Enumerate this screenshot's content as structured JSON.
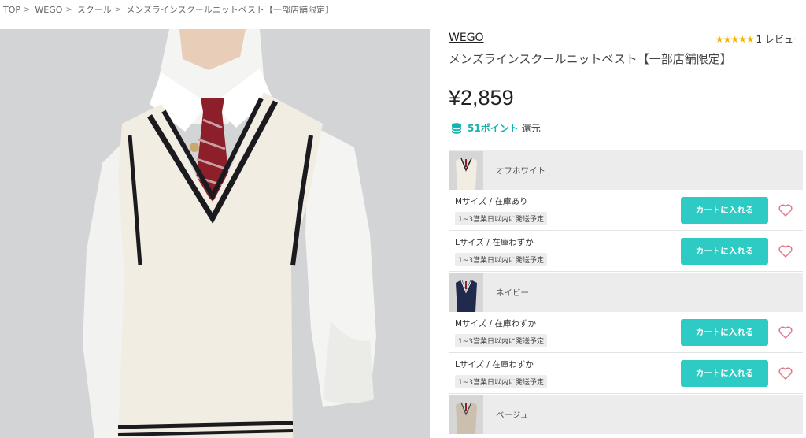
{
  "breadcrumb": [
    {
      "label": "TOP"
    },
    {
      "label": "WEGO"
    },
    {
      "label": "スクール"
    },
    {
      "label": "メンズラインスクールニットベスト【一部店舗限定】"
    }
  ],
  "breadcrumb_separator": ">",
  "product": {
    "brand": "WEGO",
    "rating_stars": "★★★★★",
    "rating_value": 5,
    "review_count": "1 レビュー",
    "title": "メンズラインスクールニットベスト【一部店舗限定】",
    "price": "¥2,859",
    "points_value": "51ポイント",
    "points_suffix": "還元"
  },
  "colors": [
    {
      "name": "オフホワイト",
      "thumb_color": "#f1ede2",
      "sizes": [
        {
          "label": "Mサイズ / 在庫あり",
          "shipping": "1~3営業日以内に発送予定",
          "button": "カートに入れる"
        },
        {
          "label": "Lサイズ / 在庫わずか",
          "shipping": "1~3営業日以内に発送予定",
          "button": "カートに入れる"
        }
      ]
    },
    {
      "name": "ネイビー",
      "thumb_color": "#1f2a4d",
      "sizes": [
        {
          "label": "Mサイズ / 在庫わずか",
          "shipping": "1~3営業日以内に発送予定",
          "button": "カートに入れる"
        },
        {
          "label": "Lサイズ / 在庫わずか",
          "shipping": "1~3営業日以内に発送予定",
          "button": "カートに入れる"
        }
      ]
    },
    {
      "name": "ベージュ",
      "thumb_color": "#cbbfae",
      "sizes": []
    }
  ],
  "colors_theme": {
    "accent": "#2dcbc3",
    "points": "#17b3ad",
    "star": "#f5b400",
    "heart": "#e07a8a"
  },
  "icons": {
    "points": "coin-stack-icon",
    "wishlist": "heart-outline-icon",
    "rating": "star-icon"
  }
}
